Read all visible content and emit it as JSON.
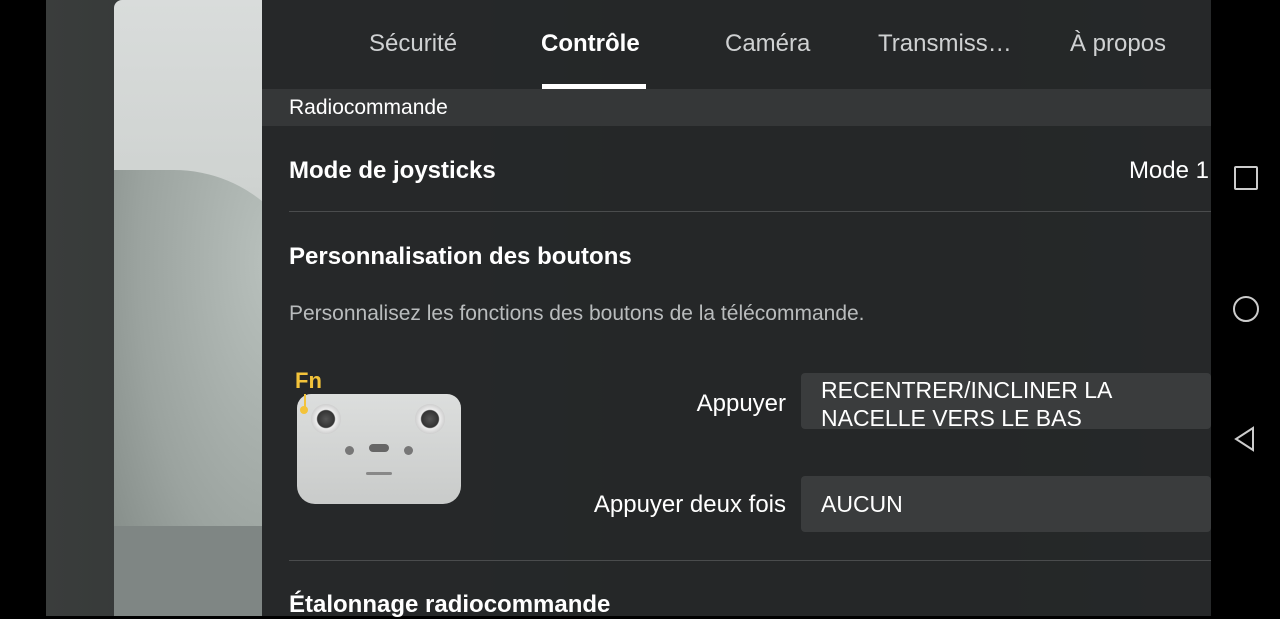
{
  "tabs": [
    {
      "label": "Sécurité"
    },
    {
      "label": "Contrôle"
    },
    {
      "label": "Caméra"
    },
    {
      "label": "Transmiss…"
    },
    {
      "label": "À propos"
    }
  ],
  "active_tab": "Contrôle",
  "section": {
    "title": "Radiocommande"
  },
  "joystick": {
    "label": "Mode de joysticks",
    "value": "Mode 1"
  },
  "buttons": {
    "title": "Personnalisation des boutons",
    "description": "Personnalisez les fonctions des boutons de la télécommande.",
    "fn_label": "Fn",
    "press": {
      "label": "Appuyer",
      "value_line1": "RECENTRER/INCLINER LA",
      "value_line2": "NACELLE VERS LE BAS"
    },
    "double_press": {
      "label": "Appuyer deux fois",
      "value": "AUCUN"
    }
  },
  "calibration": {
    "label": "Étalonnage radiocommande"
  },
  "colors": {
    "accent": "#ffffff",
    "fn": "#f3c33a",
    "panel": "#262829"
  },
  "system_nav": {
    "items": [
      "recent-apps-icon",
      "home-icon",
      "back-icon"
    ]
  }
}
